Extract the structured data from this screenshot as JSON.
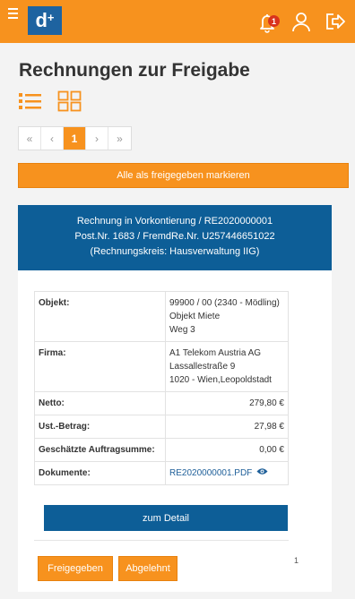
{
  "header": {
    "logo_text": "d",
    "logo_sup": "+",
    "notification_count": "1",
    "accent_color": "#f7921e",
    "brand_color": "#1e63a0",
    "icons": [
      "menu-icon",
      "bell-icon",
      "user-icon",
      "logout-icon"
    ]
  },
  "page": {
    "title": "Rechnungen zur Freigabe",
    "view_icons": [
      "list-view-icon",
      "grid-view-icon"
    ]
  },
  "pagination": {
    "first": "«",
    "prev": "‹",
    "current": "1",
    "next": "›",
    "last": "»"
  },
  "actions": {
    "mark_all": "Alle als freigegeben markieren"
  },
  "invoice": {
    "header_line1": "Rechnung in Vorkontierung / RE2020000001",
    "header_line2": "Post.Nr. 1683 / FremdRe.Nr. U257446651022",
    "header_line3": "(Rechnungskreis: Hausverwaltung IIG)",
    "objekt_label": "Objekt:",
    "objekt_line1": "99900 / 00 (2340 - Mödling)",
    "objekt_line2": "Objekt Miete",
    "objekt_line3": "Weg 3",
    "firma_label": "Firma:",
    "firma_line1": "A1 Telekom Austria AG",
    "firma_line2": "Lassallestraße 9",
    "firma_line3": "1020 - Wien,Leopoldstadt",
    "netto_label": "Netto:",
    "netto_value": "279,80 €",
    "ust_label": "Ust.-Betrag:",
    "ust_value": "27,98 €",
    "auftrag_label": "Geschätzte Auftragsumme:",
    "auftrag_value": "0,00 €",
    "dokumente_label": "Dokumente:",
    "dokumente_value": "RE2020000001.PDF",
    "detail_button": "zum Detail",
    "approve_button": "Freigegeben",
    "reject_button": "Abgelehnt",
    "page_number": "1"
  }
}
